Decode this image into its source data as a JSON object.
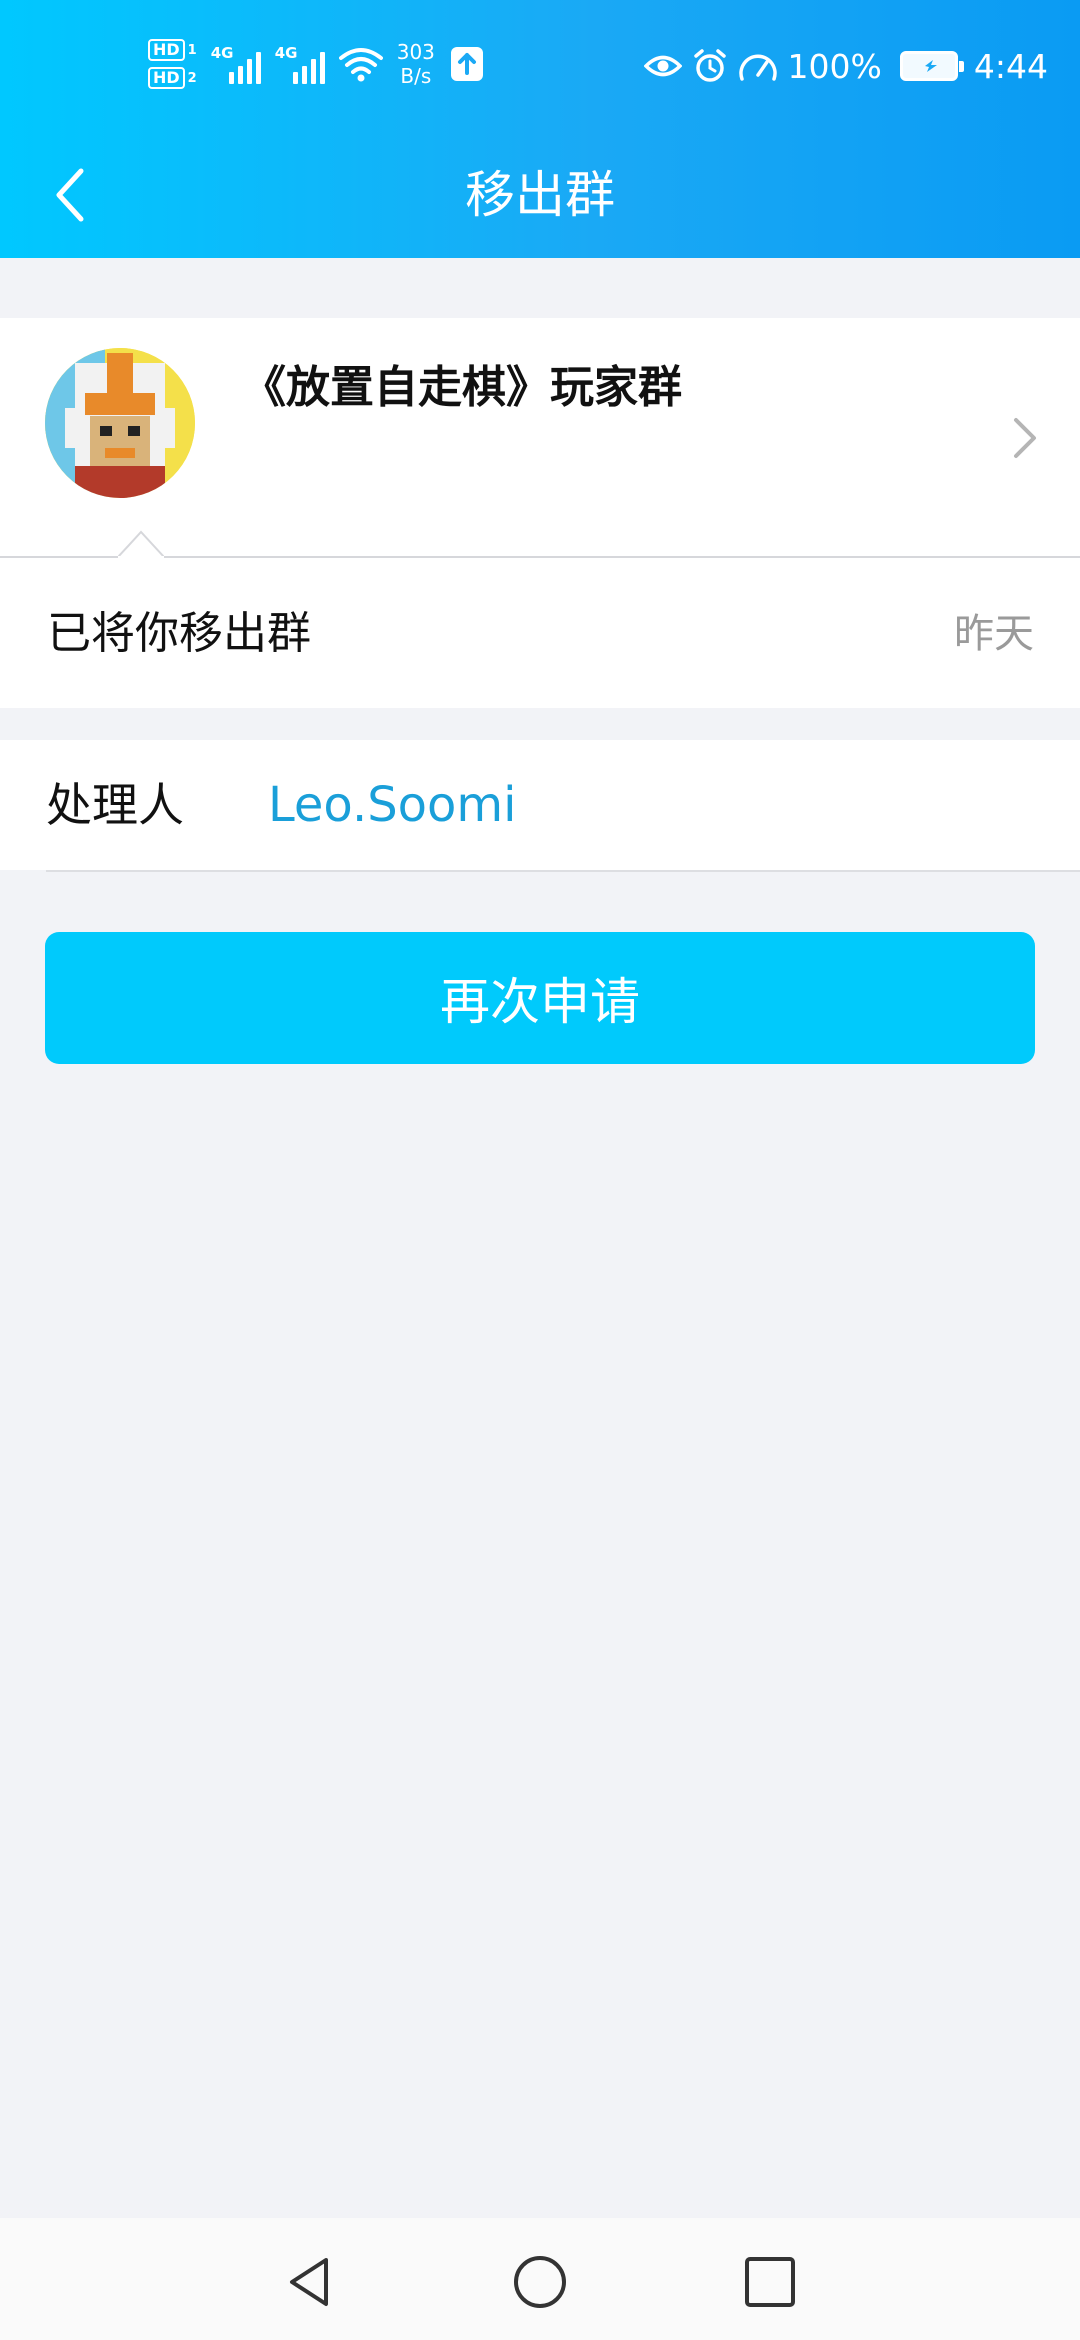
{
  "status_bar": {
    "hd1": "HD",
    "hd1_num": "1",
    "hd2": "HD",
    "hd2_num": "2",
    "net1": "4G",
    "net2": "4G",
    "speed_value": "303",
    "speed_unit": "B/s",
    "battery_percent": "100%",
    "time": "4:44",
    "icons": [
      "eye-icon",
      "alarm-icon",
      "speedometer-icon",
      "battery-charging-icon",
      "upload-icon",
      "wifi-icon",
      "signal-icon"
    ]
  },
  "title_bar": {
    "title": "移出群",
    "back_icon": "chevron-left-icon"
  },
  "group": {
    "name": "《放置自走棋》玩家群",
    "avatar": "knight-avatar",
    "chevron_icon": "chevron-right-icon"
  },
  "notice": {
    "message": "已将你移出群",
    "time": "昨天"
  },
  "handler": {
    "label": "处理人",
    "name": "Leo.Soomi"
  },
  "actions": {
    "reapply_label": "再次申请"
  },
  "nav_bar": {
    "icons": [
      "back-triangle-icon",
      "home-circle-icon",
      "recents-square-icon"
    ]
  },
  "colors": {
    "header_gradient_start": "#00c8ff",
    "header_gradient_end": "#0a9bf3",
    "button": "#00cafc",
    "link": "#1a9fd9",
    "background": "#f2f3f7"
  }
}
